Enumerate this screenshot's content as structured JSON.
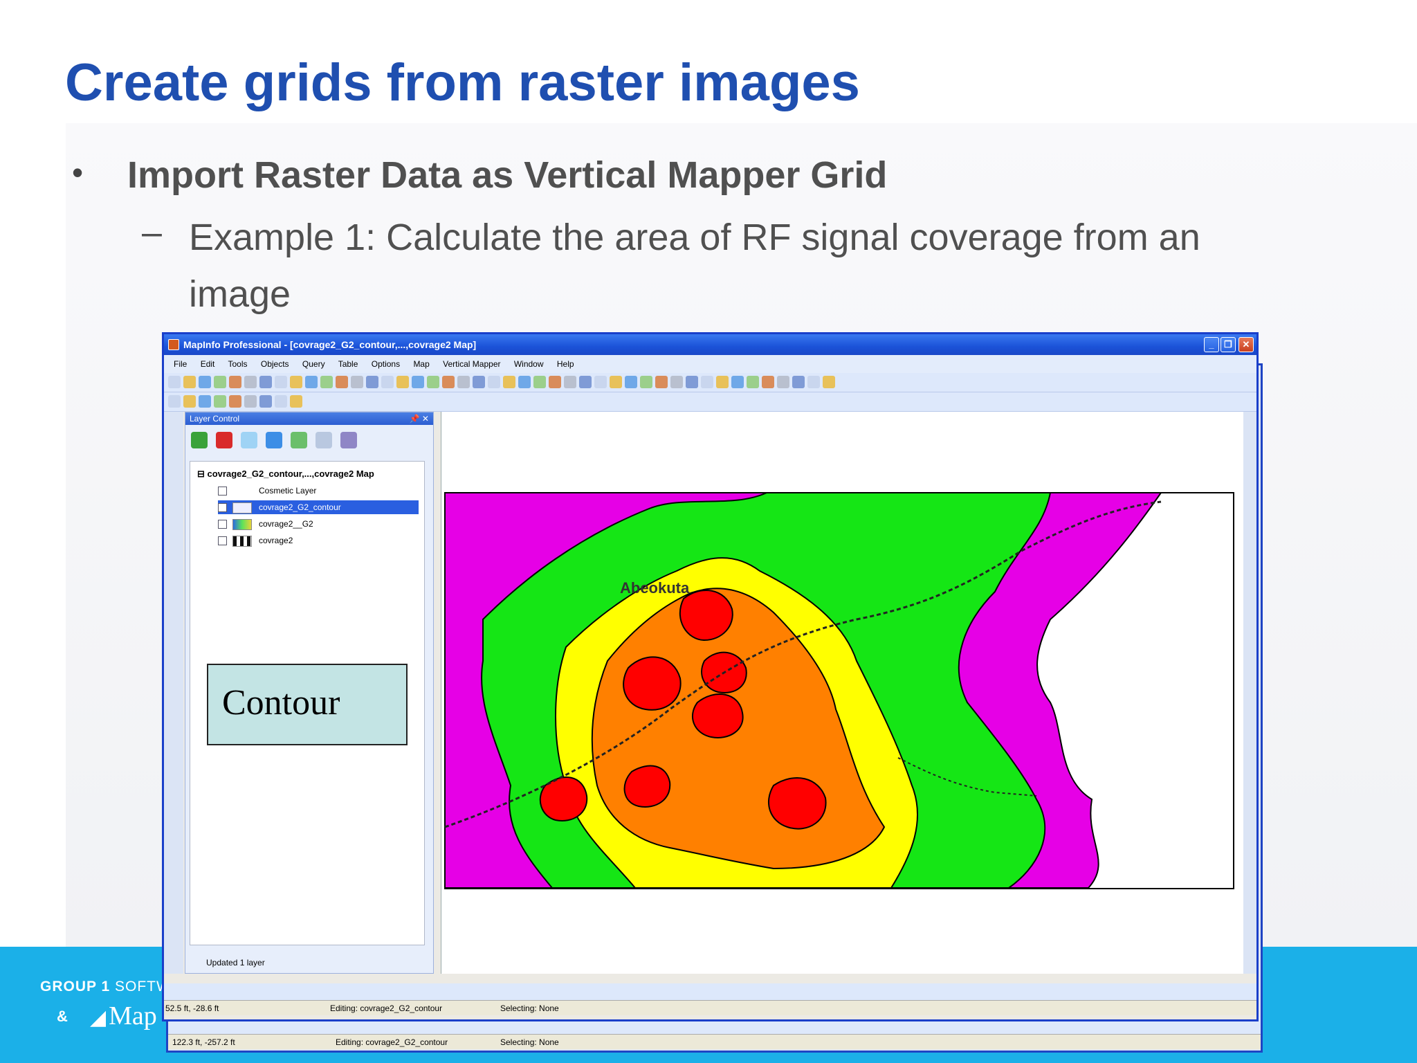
{
  "slide": {
    "title": "Create grids from raster images",
    "bullet1": "Import Raster Data as Vertical Mapper Grid",
    "bullet2": "Example 1: Calculate the area of RF signal coverage from an image",
    "bullet_marker": "•",
    "sub_marker": "–",
    "footer": {
      "brand_group": "GROUP",
      "brand_sep": "1",
      "brand_soft": "SOFTW",
      "amp": "&",
      "brand_map": "Map"
    }
  },
  "window": {
    "title": "MapInfo Professional - [covrage2_G2_contour,...,covrage2 Map]",
    "menu": [
      "File",
      "Edit",
      "Tools",
      "Objects",
      "Query",
      "Table",
      "Options",
      "Map",
      "Vertical Mapper",
      "Window",
      "Help"
    ],
    "layer_control": {
      "title": "Layer Control",
      "root": "covrage2_G2_contour,...,covrage2 Map",
      "layers": [
        "Cosmetic Layer",
        "covrage2_G2_contour",
        "covrage2__G2",
        "covrage2"
      ],
      "status": "Updated 1 layer"
    },
    "callout": "Contour",
    "map_labels": {
      "center_town": "Abeokuta"
    },
    "status_top": {
      "coords": "52.5 ft, -28.6 ft",
      "editing": "Editing: covrage2_G2_contour",
      "selecting": "Selecting: None"
    },
    "status_bottom": {
      "coords": "122.3 ft, -257.2 ft",
      "editing": "Editing: covrage2_G2_contour",
      "selecting": "Selecting: None"
    }
  },
  "colors": {
    "title": "#1f4fb0",
    "footer": "#1bb0e8",
    "magenta": "#e600e6",
    "green": "#15e615",
    "yellow": "#ffff00",
    "orange": "#ff8000",
    "red": "#ff0000"
  }
}
